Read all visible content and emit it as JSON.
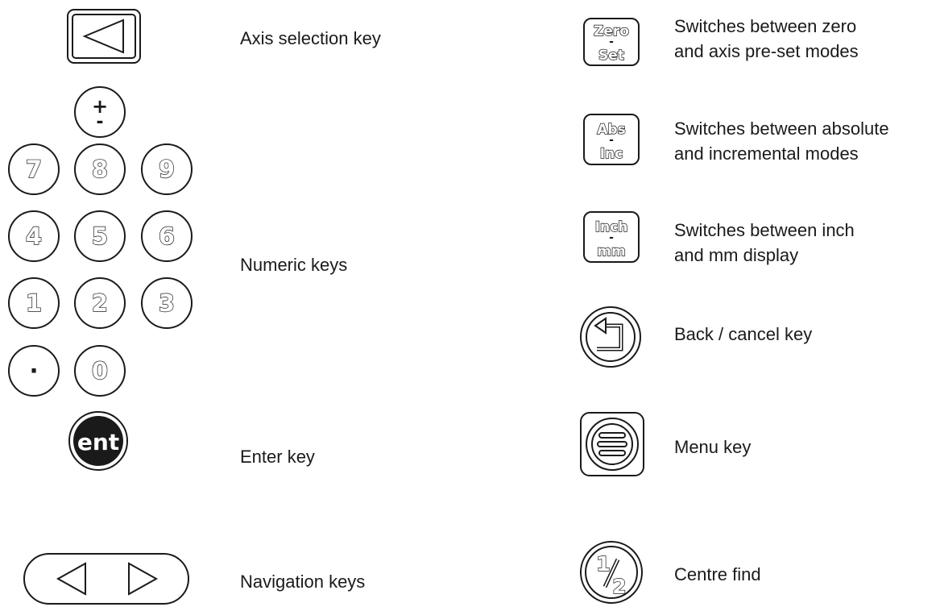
{
  "left_keys": {
    "axis_selection": {
      "label": "Axis selection key"
    },
    "numeric": {
      "label": "Numeric keys",
      "sign_key": {
        "top": "+",
        "bottom": "-"
      },
      "digits": [
        "7",
        "8",
        "9",
        "4",
        "5",
        "6",
        "1",
        "2",
        "3",
        "·",
        "0"
      ]
    },
    "enter": {
      "key_text": "ent",
      "label": "Enter key"
    },
    "navigation": {
      "label": "Navigation keys"
    }
  },
  "right_keys": {
    "zero_set": {
      "top": "Zero",
      "mid": "-",
      "bottom": "Set",
      "line1": "Switches between zero",
      "line2": "and axis pre-set modes"
    },
    "abs_inc": {
      "top": "Abs",
      "mid": "-",
      "bottom": "Inc",
      "line1": "Switches between absolute",
      "line2": "and incremental modes"
    },
    "inch_mm": {
      "top": "Inch",
      "mid": "-",
      "bottom": "mm",
      "line1": "Switches between inch",
      "line2": "and mm display"
    },
    "back": {
      "label": "Back / cancel key"
    },
    "menu": {
      "label": "Menu key"
    },
    "centre": {
      "num": "1",
      "den": "2",
      "label": "Centre find"
    }
  }
}
